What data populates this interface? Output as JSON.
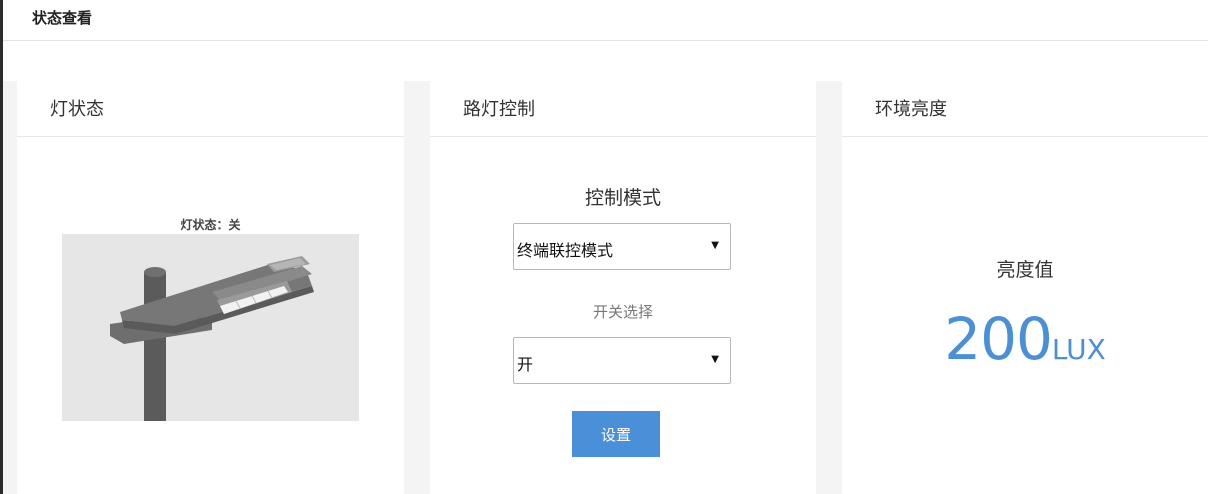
{
  "page": {
    "title": "状态查看"
  },
  "lamp_card": {
    "title": "灯状态",
    "status_text": "灯状态：关",
    "image_icon": "street-lamp-image"
  },
  "control_card": {
    "title": "路灯控制",
    "mode_label": "控制模式",
    "mode_value": "终端联控模式",
    "switch_label": "开关选择",
    "switch_value": "开",
    "set_button": "设置"
  },
  "light_card": {
    "title": "环境亮度",
    "value_label": "亮度值",
    "value": "200",
    "unit": "LUX"
  },
  "colors": {
    "accent": "#4a90d9",
    "card_bg": "#ffffff",
    "page_bg": "#f4f4f4"
  }
}
